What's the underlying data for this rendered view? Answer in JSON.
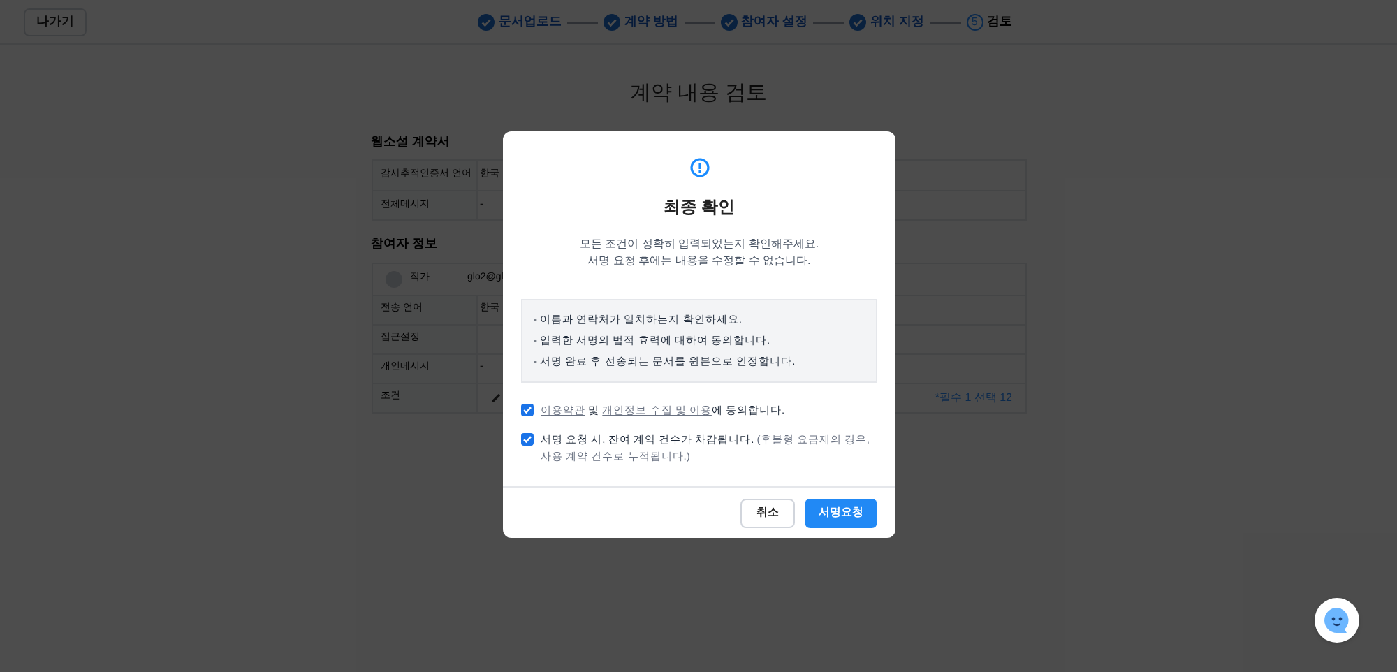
{
  "header": {
    "exit_button": "나가기",
    "steps": [
      {
        "label": "문서업로드",
        "done": true
      },
      {
        "label": "계약 방법",
        "done": true
      },
      {
        "label": "참여자 설정",
        "done": true
      },
      {
        "label": "위치 지정",
        "done": true
      },
      {
        "number": "5",
        "label": "검토",
        "done": false
      }
    ]
  },
  "page_title": "계약 내용 검토",
  "document": {
    "title": "웹소설 계약서",
    "rows": [
      {
        "label": "감사추적인증서 언어",
        "value": "한국"
      },
      {
        "label": "전체메시지",
        "value": "-"
      }
    ]
  },
  "participants": {
    "title": "참여자 정보",
    "name": "작가",
    "email": "glo2@gl",
    "rows": [
      {
        "kind": "text",
        "label": "전송 언어",
        "value": "한국"
      },
      {
        "kind": "text",
        "label": "접근설정"
      },
      {
        "kind": "text",
        "label": "개인메시지",
        "value": "-"
      },
      {
        "kind": "conditions",
        "label": "조건",
        "count": "*필수 1 선택 12"
      }
    ]
  },
  "modal": {
    "title": "최종 확인",
    "message": [
      "모든 조건이 정확히 입력되었는지 확인해주세요.",
      "서명 요청 후에는 내용을 수정할 수 없습니다."
    ],
    "notes": [
      "- 이름과 연락처가 일치하는지 확인하세요.",
      "- 입력한 서명의 법적 효력에 대하여 동의합니다.",
      "- 서명 완료 후 전송되는 문서를 원본으로 인정합니다."
    ],
    "agreements": [
      {
        "checked": true,
        "parts": [
          {
            "kind": "link",
            "text": "이용약관"
          },
          {
            "kind": "text",
            "text": " 및 "
          },
          {
            "kind": "link",
            "text": "개인정보 수집 및 이용"
          },
          {
            "kind": "text",
            "text": "에 동의합니다."
          }
        ]
      },
      {
        "checked": true,
        "parts": [
          {
            "kind": "text",
            "text": "서명 요청 시, 잔여 계약 건수가 차감됩니다. "
          },
          {
            "kind": "note",
            "text": "(후불형 요금제의 경우, 사용 계약 건수로 누적됩니다.)"
          }
        ]
      }
    ],
    "cancel_button": "취소",
    "confirm_button": "서명요청"
  }
}
